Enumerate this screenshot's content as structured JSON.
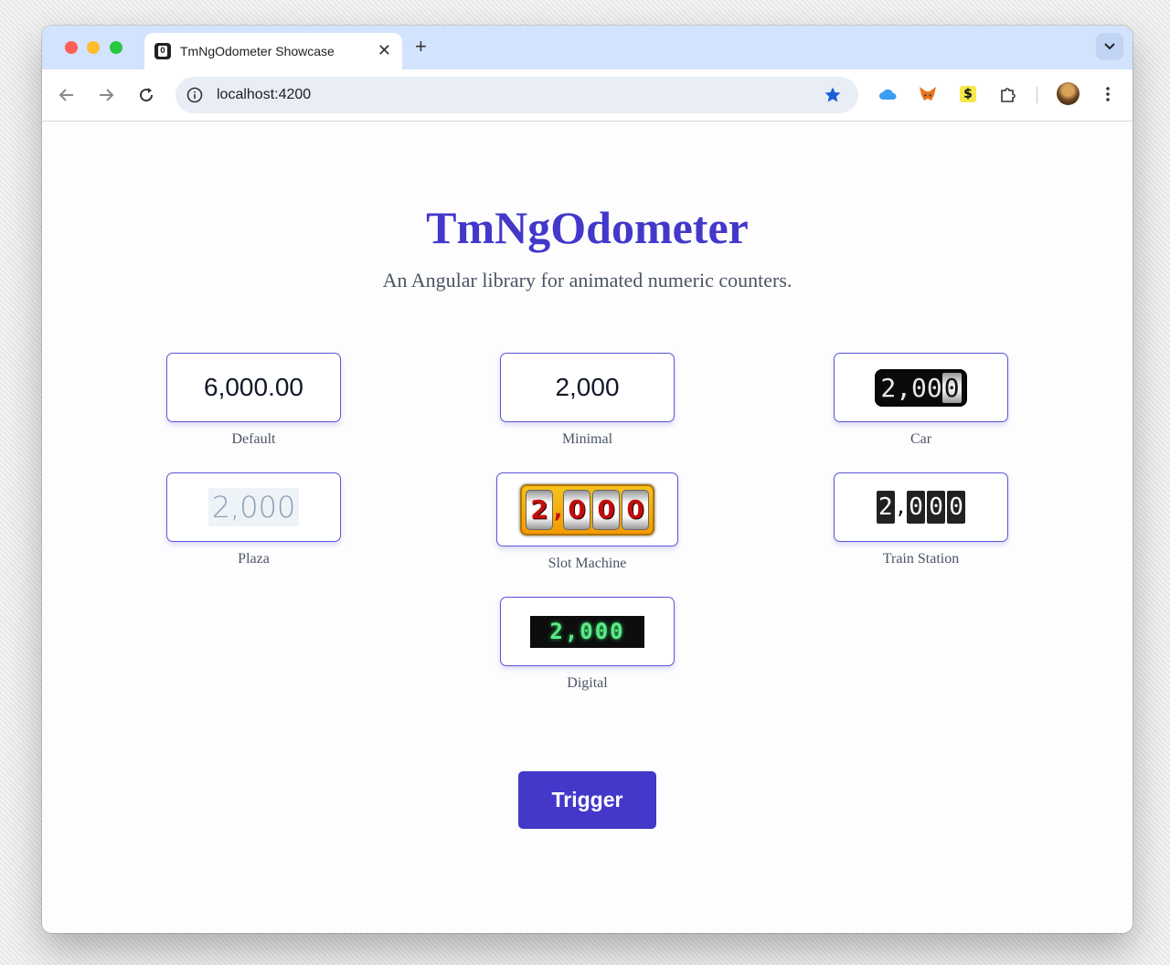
{
  "browser": {
    "tab_title": "TmNgOdometer Showcase",
    "tab_favicon_letter": "O",
    "tab_close": "✕",
    "new_tab": "+",
    "url": "localhost:4200",
    "icons": [
      "back-icon",
      "forward-icon",
      "reload-icon",
      "site-info-icon",
      "bookmark-star-icon",
      "icloud-extension-icon",
      "metamask-extension-icon",
      "dollar-extension-icon",
      "extensions-puzzle-icon",
      "profile-avatar",
      "more-menu-icon"
    ]
  },
  "page": {
    "title": "TmNgOdometer",
    "subtitle": "An Angular library for animated numeric counters."
  },
  "odometers": {
    "default": {
      "label": "Default",
      "value": "6,000.00"
    },
    "minimal": {
      "label": "Minimal",
      "value": "2,000"
    },
    "car": {
      "label": "Car",
      "value_main": "2,00",
      "value_last": "0"
    },
    "plaza": {
      "label": "Plaza",
      "value": "2,000"
    },
    "slot_machine": {
      "label": "Slot Machine",
      "digits": [
        "2",
        ",",
        "0",
        "0",
        "0"
      ]
    },
    "train_station": {
      "label": "Train Station",
      "digits": [
        "2",
        ",",
        "0",
        "0",
        "0"
      ]
    },
    "digital": {
      "label": "Digital",
      "value": "2,000"
    }
  },
  "trigger_label": "Trigger",
  "colors": {
    "accent": "#4338ca",
    "tab_bar": "#d3e3fd",
    "digital_green": "#5ee88a"
  }
}
